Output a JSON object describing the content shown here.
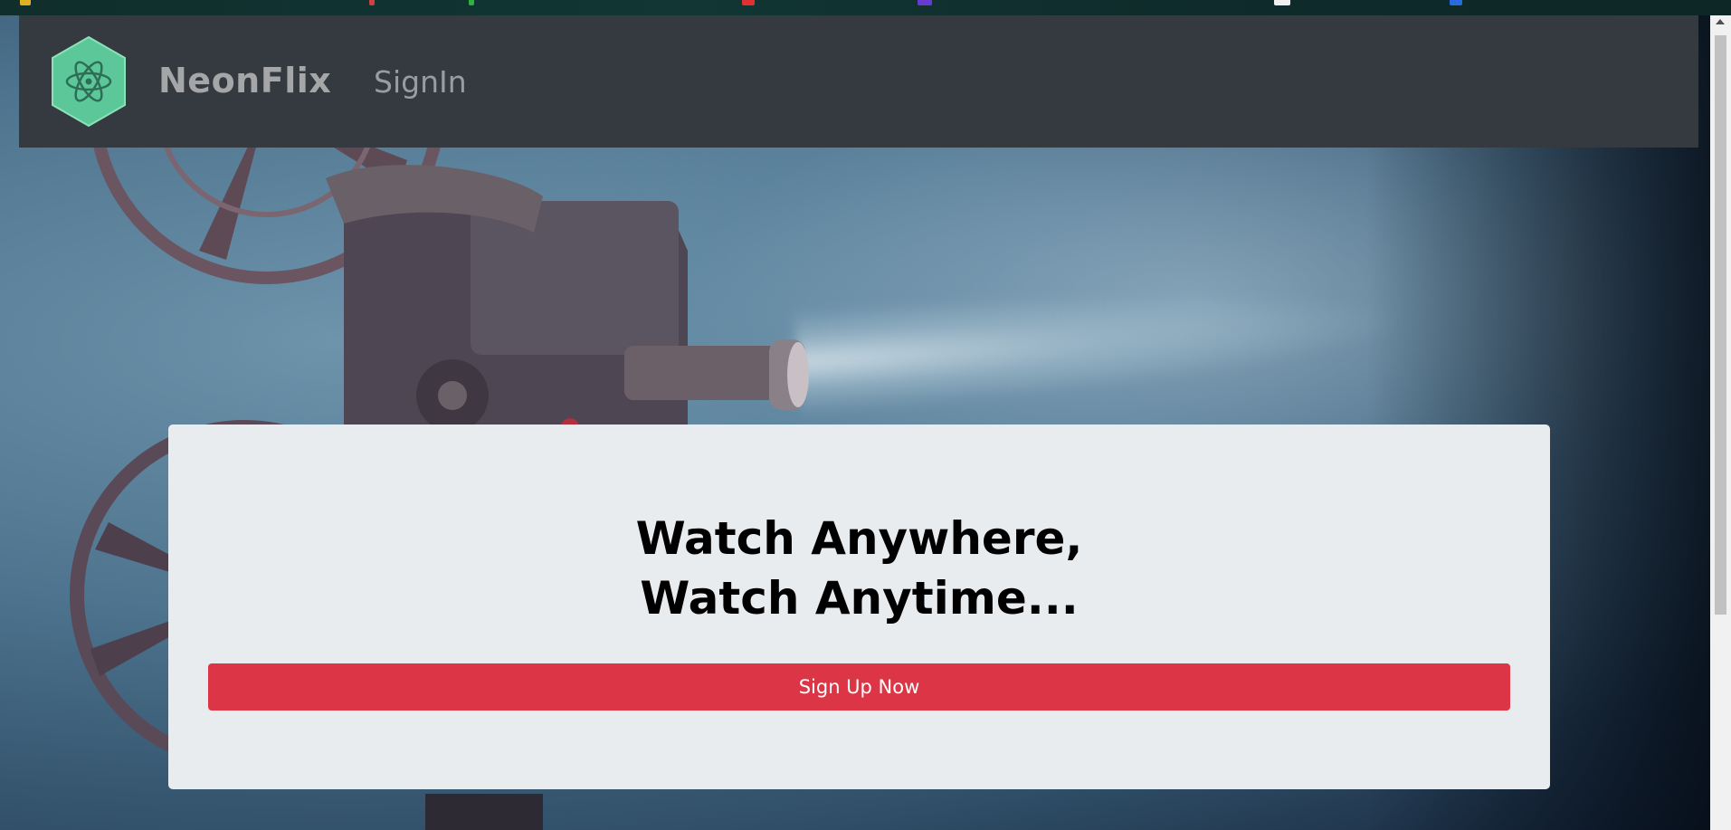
{
  "navbar": {
    "brand": "NeonFlix",
    "signin_label": "SignIn",
    "logo_icon": "atom-hexagon-icon",
    "background": "#343a40"
  },
  "hero": {
    "headline_line1": "Watch Anywhere,",
    "headline_line2": "Watch Anytime...",
    "signup_label": "Sign Up Now",
    "signup_color": "#dc3545",
    "card_color": "#e9ecef"
  }
}
